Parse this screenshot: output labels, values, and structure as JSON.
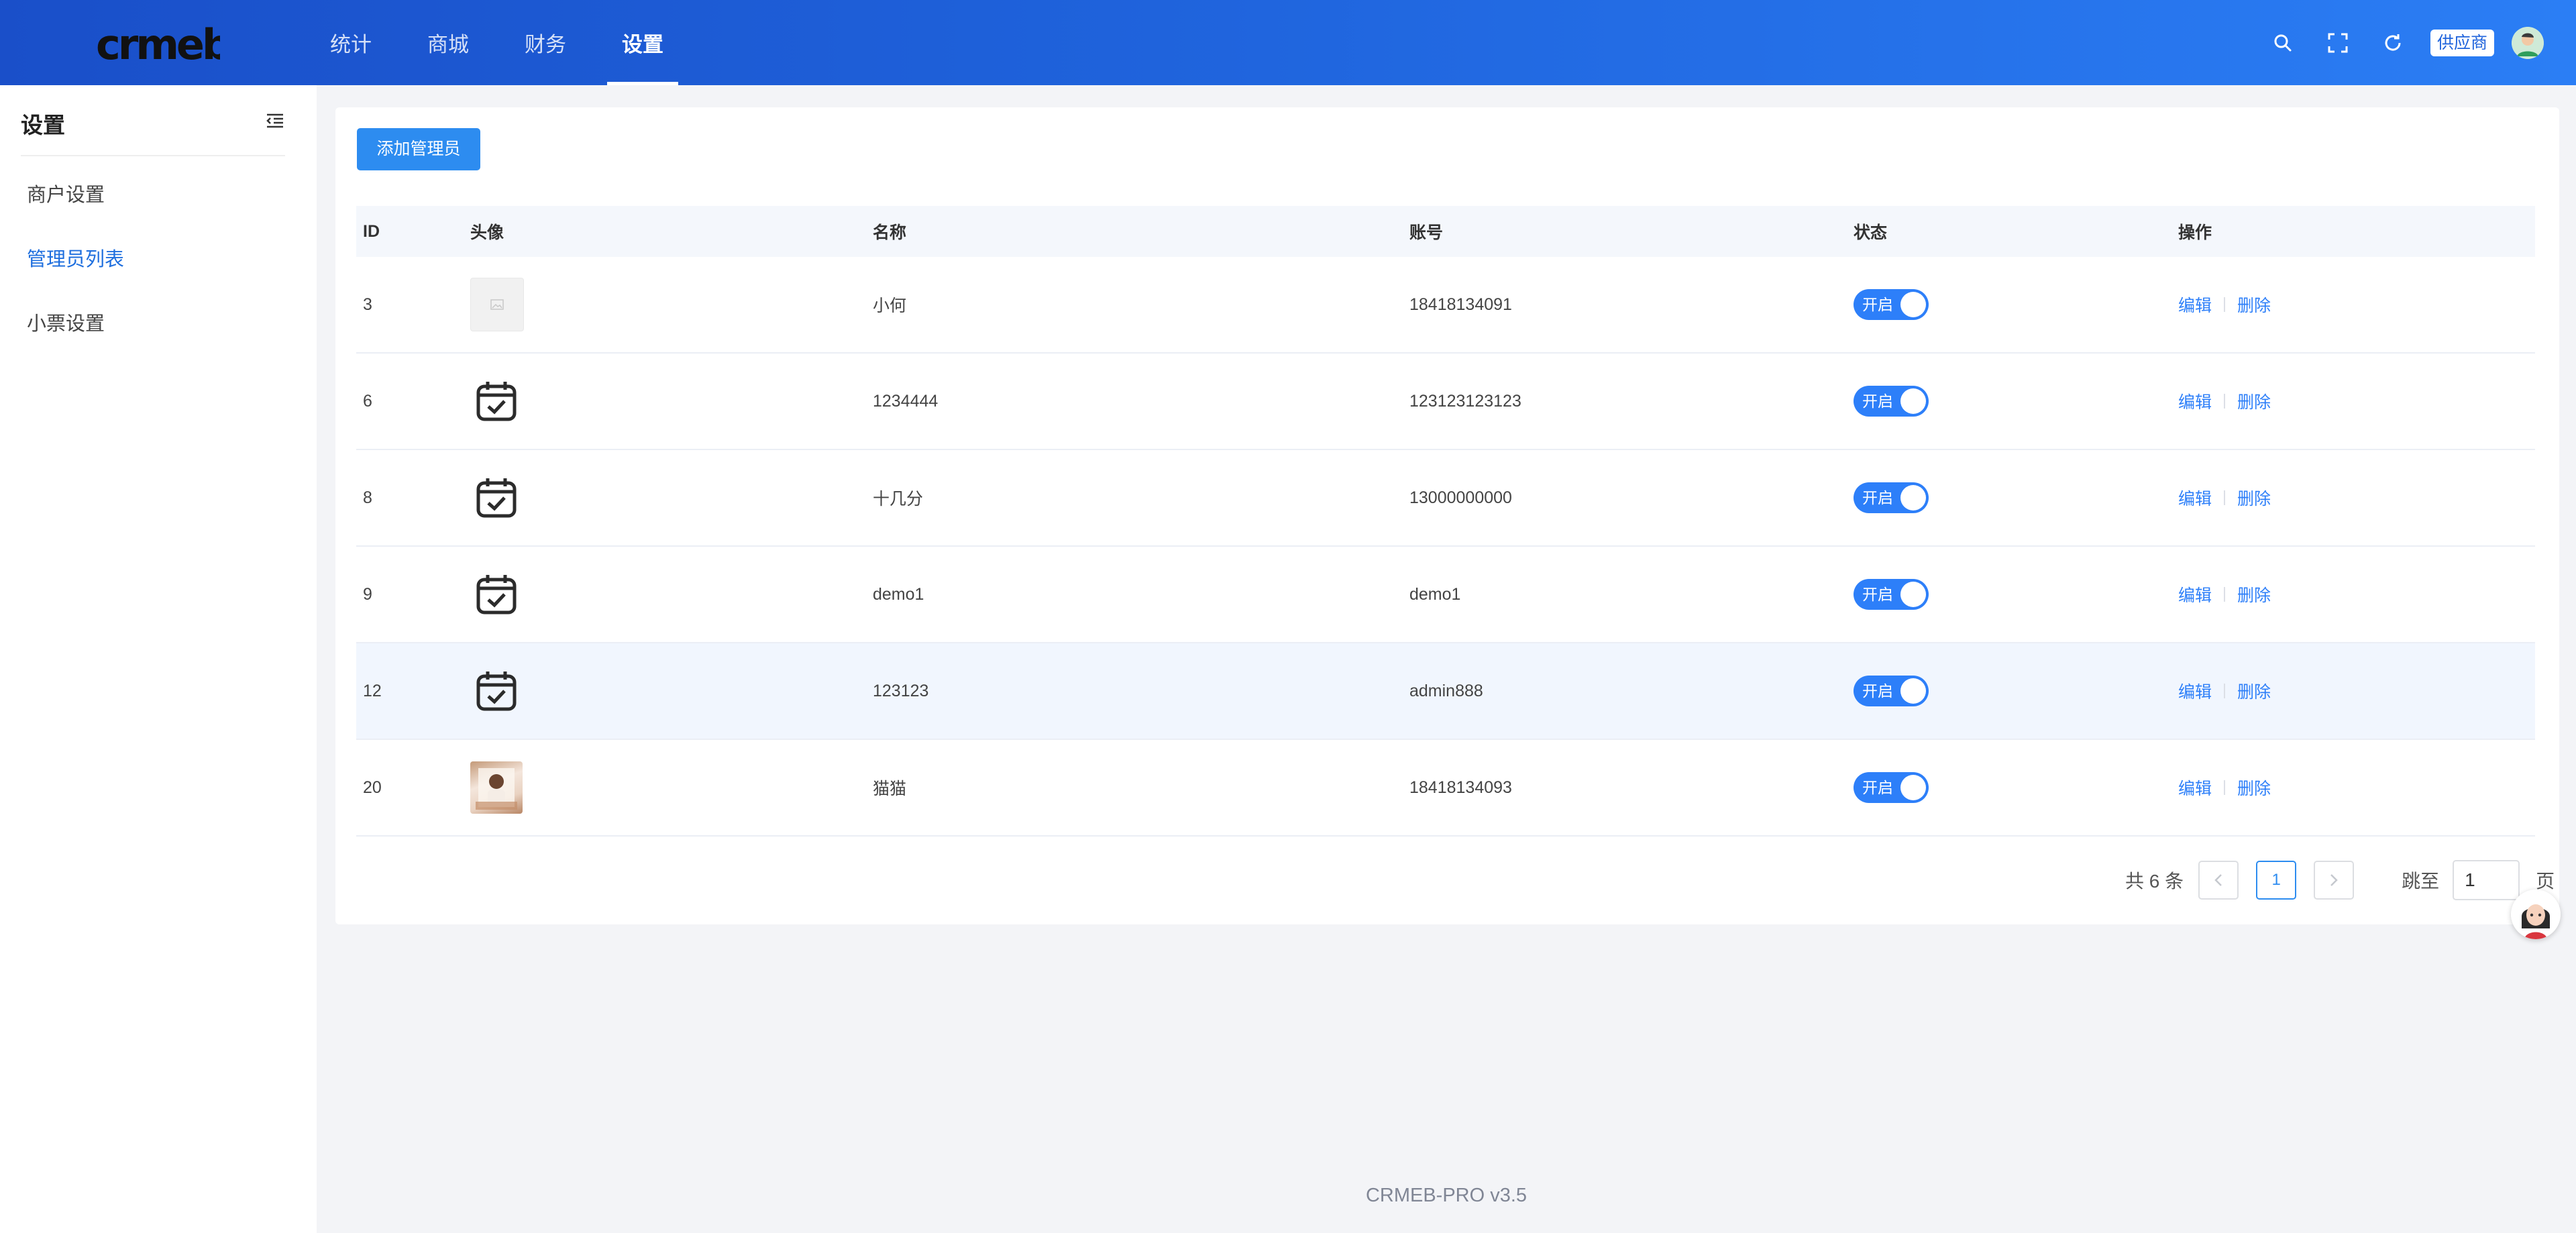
{
  "header": {
    "logo_text": "crmeb",
    "nav": [
      {
        "label": "统计",
        "active": false
      },
      {
        "label": "商城",
        "active": false
      },
      {
        "label": "财务",
        "active": false
      },
      {
        "label": "设置",
        "active": true
      }
    ],
    "icons": [
      "search-icon",
      "fullscreen-icon",
      "refresh-icon"
    ],
    "supplier_label": "供应商"
  },
  "sidebar": {
    "title": "设置",
    "items": [
      {
        "label": "商户设置",
        "active": false
      },
      {
        "label": "管理员列表",
        "active": true
      },
      {
        "label": "小票设置",
        "active": false
      }
    ]
  },
  "main": {
    "add_button": "添加管理员",
    "columns": [
      "ID",
      "头像",
      "名称",
      "账号",
      "状态",
      "操作"
    ],
    "rows": [
      {
        "id": "3",
        "avatar": "placeholder-image",
        "name": "小何",
        "account": "18418134091",
        "status": "开启",
        "edit": "编辑",
        "delete": "删除"
      },
      {
        "id": "6",
        "avatar": "calendar-check-icon",
        "name": "1234444",
        "account": "123123123123",
        "status": "开启",
        "edit": "编辑",
        "delete": "删除"
      },
      {
        "id": "8",
        "avatar": "calendar-check-icon",
        "name": "十几分",
        "account": "13000000000",
        "status": "开启",
        "edit": "编辑",
        "delete": "删除"
      },
      {
        "id": "9",
        "avatar": "calendar-check-icon",
        "name": "demo1",
        "account": "demo1",
        "status": "开启",
        "edit": "编辑",
        "delete": "删除"
      },
      {
        "id": "12",
        "avatar": "calendar-check-icon",
        "name": "123123",
        "account": "admin888",
        "status": "开启",
        "edit": "编辑",
        "delete": "删除"
      },
      {
        "id": "20",
        "avatar": "photo-thumbnail",
        "name": "猫猫",
        "account": "18418134093",
        "status": "开启",
        "edit": "编辑",
        "delete": "删除"
      }
    ],
    "highlighted_row_id": "12"
  },
  "pagination": {
    "total": "共 6 条",
    "current_page": "1",
    "jump_label": "跳至",
    "jump_value": "1",
    "page_unit": "页"
  },
  "footer": {
    "text": "CRMEB-PRO v3.5"
  },
  "colors": {
    "primary": "#2d8cf0",
    "header_from": "#1a4fc9",
    "header_to": "#2b7ef5",
    "switch_on": "#2d7ff9"
  }
}
